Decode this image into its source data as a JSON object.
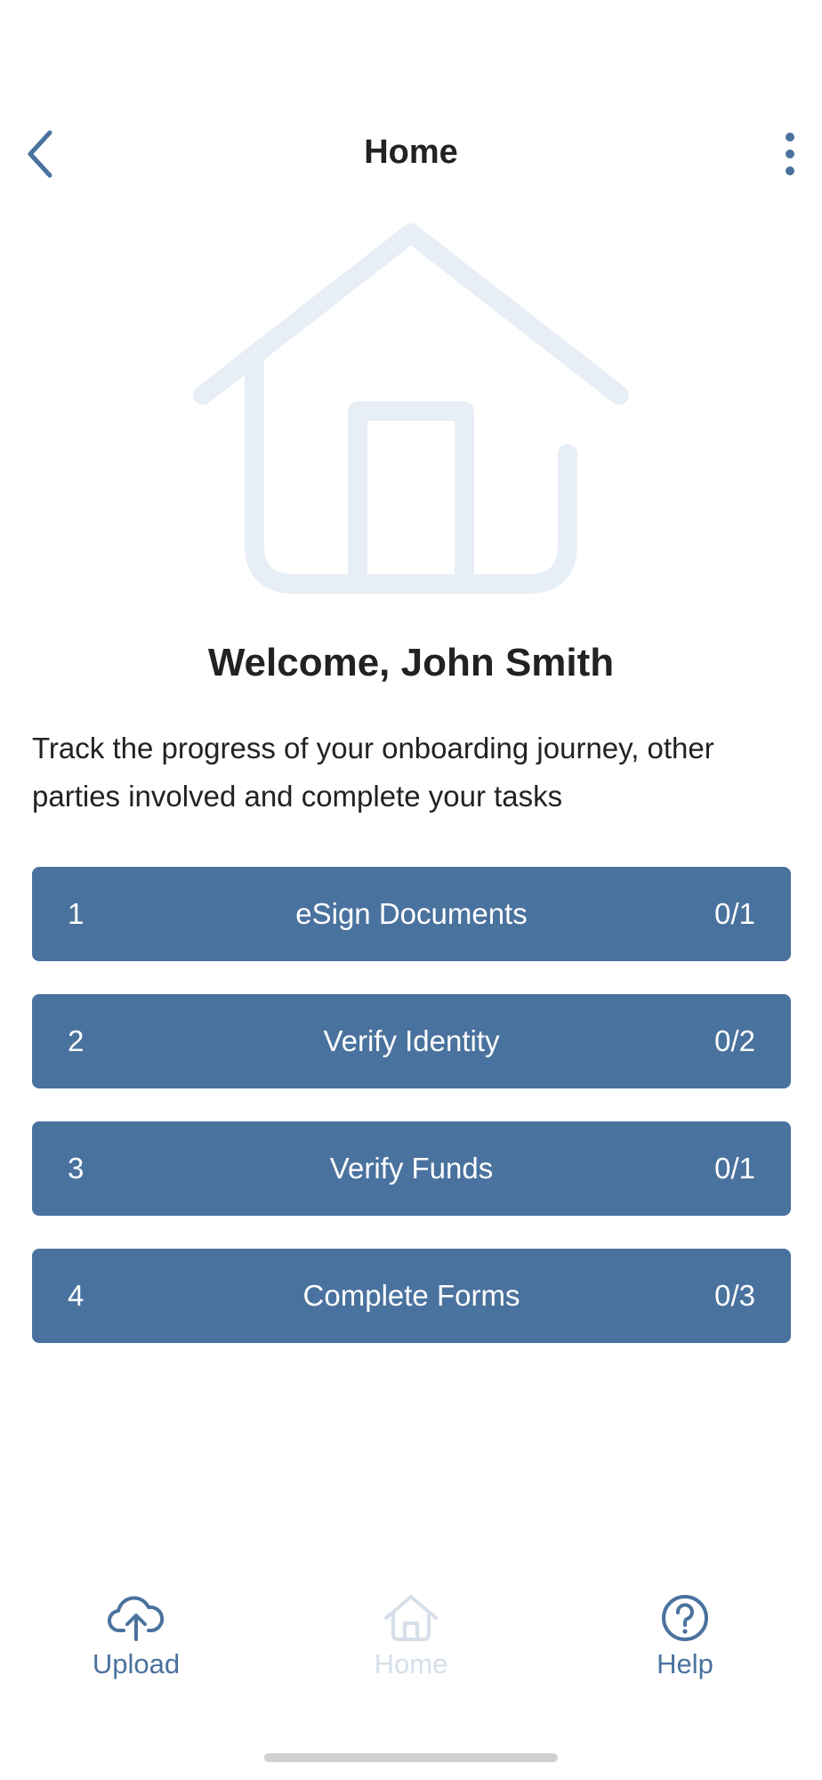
{
  "header": {
    "title": "Home",
    "back_icon": "chevron-left-icon",
    "menu_icon": "vertical-dots-icon"
  },
  "hero": {
    "icon": "house-icon"
  },
  "welcome": {
    "heading": "Welcome, John Smith",
    "description": "Track the progress of your onboarding journey, other parties involved and complete your tasks"
  },
  "tasks": [
    {
      "number": "1",
      "title": "eSign Documents",
      "progress": "0/1"
    },
    {
      "number": "2",
      "title": "Verify Identity",
      "progress": "0/2"
    },
    {
      "number": "3",
      "title": "Verify Funds",
      "progress": "0/1"
    },
    {
      "number": "4",
      "title": "Complete Forms",
      "progress": "0/3"
    }
  ],
  "tabbar": {
    "upload": {
      "label": "Upload",
      "icon": "cloud-upload-icon"
    },
    "home": {
      "label": "Home",
      "icon": "house-icon"
    },
    "help": {
      "label": "Help",
      "icon": "help-circle-icon"
    }
  },
  "colors": {
    "accent": "#4a729e",
    "task_background": "#4a729e",
    "illustration": "#e8eef5",
    "tab_inactive": "#d6dfe9",
    "text": "#222222"
  }
}
